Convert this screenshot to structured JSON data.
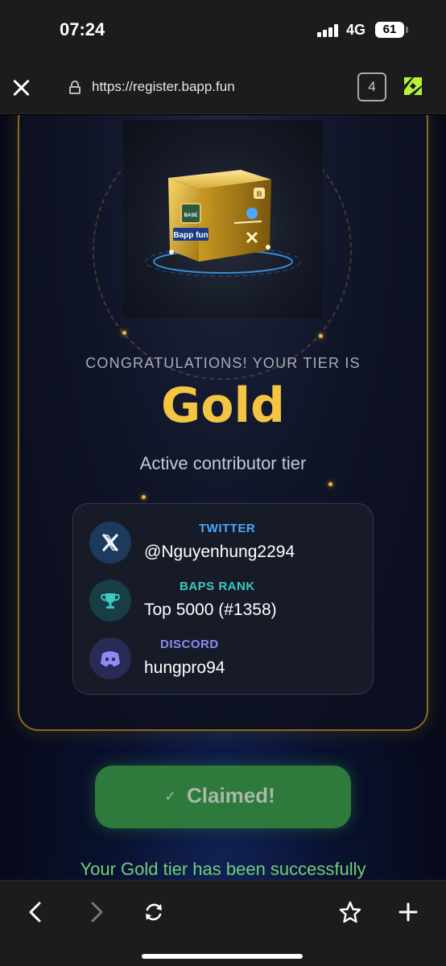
{
  "status_bar": {
    "time": "07:24",
    "network": "4G",
    "battery": "61"
  },
  "browser": {
    "url": "https://register.bapp.fun",
    "tab_count": "4"
  },
  "hero": {
    "box_label_base": "BASE",
    "box_label_brand": "Bapp fun",
    "box_label_b": "B"
  },
  "result": {
    "caption": "CONGRATULATIONS! YOUR TIER IS",
    "tier": "Gold",
    "description": "Active contributor tier"
  },
  "info": {
    "twitter": {
      "label": "TWITTER",
      "value": "@Nguyenhung2294",
      "icon": "x-logo-icon",
      "color": "#4aa8ff"
    },
    "rank": {
      "label": "BAPS RANK",
      "value": "Top 5000 (#1358)",
      "icon": "trophy-icon",
      "color": "#3fc7c0"
    },
    "discord": {
      "label": "DISCORD",
      "value": "hungpro94",
      "icon": "discord-icon",
      "color": "#8c8cf5"
    }
  },
  "claim": {
    "label": "Claimed!",
    "success": "Your Gold tier has been successfully"
  },
  "colors": {
    "gold": "#f4c542",
    "success": "#6fcf78",
    "button": "#2e7a3c"
  }
}
